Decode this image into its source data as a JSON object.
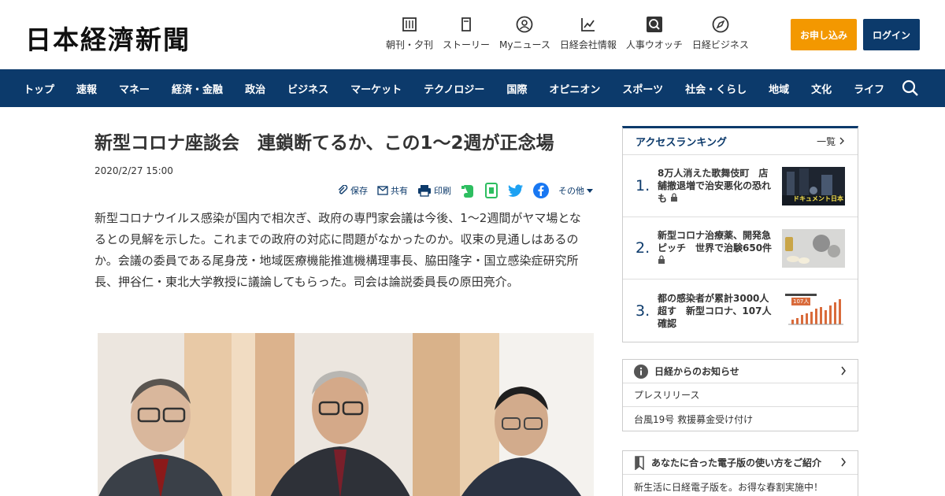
{
  "header": {
    "logo": "日本経濟新聞",
    "nav": [
      {
        "label": "朝刊・夕刊",
        "icon": "newspaper-icon"
      },
      {
        "label": "ストーリー",
        "icon": "book-icon"
      },
      {
        "label": "Myニュース",
        "icon": "user-icon"
      },
      {
        "label": "日経会社情報",
        "icon": "chart-icon"
      },
      {
        "label": "人事ウオッチ",
        "icon": "search-person-icon"
      },
      {
        "label": "日経ビジネス",
        "icon": "compass-icon"
      }
    ],
    "apply_label": "お申し込み",
    "login_label": "ログイン"
  },
  "navbar": {
    "items": [
      "トップ",
      "速報",
      "マネー",
      "経済・金融",
      "政治",
      "ビジネス",
      "マーケット",
      "テクノロジー",
      "国際",
      "オピニオン",
      "スポーツ",
      "社会・くらし",
      "地域",
      "文化",
      "ライフ"
    ]
  },
  "article": {
    "title": "新型コロナ座談会　連鎖断てるか、この1～2週が正念場",
    "date": "2020/2/27 15:00",
    "share": {
      "save": "保存",
      "share": "共有",
      "print": "印刷",
      "more": "その他"
    },
    "lead": "新型コロナウイルス感染が国内で相次ぎ、政府の専門家会議は今後、1～2週間がヤマ場となるとの見解を示した。これまでの政府の対応に問題がなかったのか。収束の見通しはあるのか。会議の委員である尾身茂・地域医療機能推進機構理事長、脇田隆字・国立感染症研究所長、押谷仁・東北大学教授に議論してもらった。司会は論説委員長の原田亮介。"
  },
  "sidebar": {
    "ranking": {
      "title": "アクセスランキング",
      "more": "一覧",
      "items": [
        {
          "num": "1.",
          "text": "8万人消えた歌舞伎町　店舗撤退増で治安悪化の恐れも",
          "thumb_caption": "ドキュメント日本"
        },
        {
          "num": "2.",
          "text": "新型コロナ治療薬、開発急ピッチ　世界で治験650件"
        },
        {
          "num": "3.",
          "text": "都の感染者が累計3000人超す　新型コロナ、107人確認",
          "thumb_caption": "107人"
        }
      ]
    },
    "notice": {
      "title": "日経からのお知らせ",
      "rows": [
        "プレスリリース",
        "台風19号 救援募金受け付け"
      ]
    },
    "guide": {
      "title": "あなたに合った電子版の使い方をご紹介",
      "rows": [
        "新生活に日経電子版を。お得な春割実施中！"
      ]
    }
  },
  "colors": {
    "navy": "#0c3a6b",
    "orange": "#f39800",
    "evernote": "#2dbe60",
    "twitter": "#1da1f2",
    "facebook": "#1877f2"
  }
}
